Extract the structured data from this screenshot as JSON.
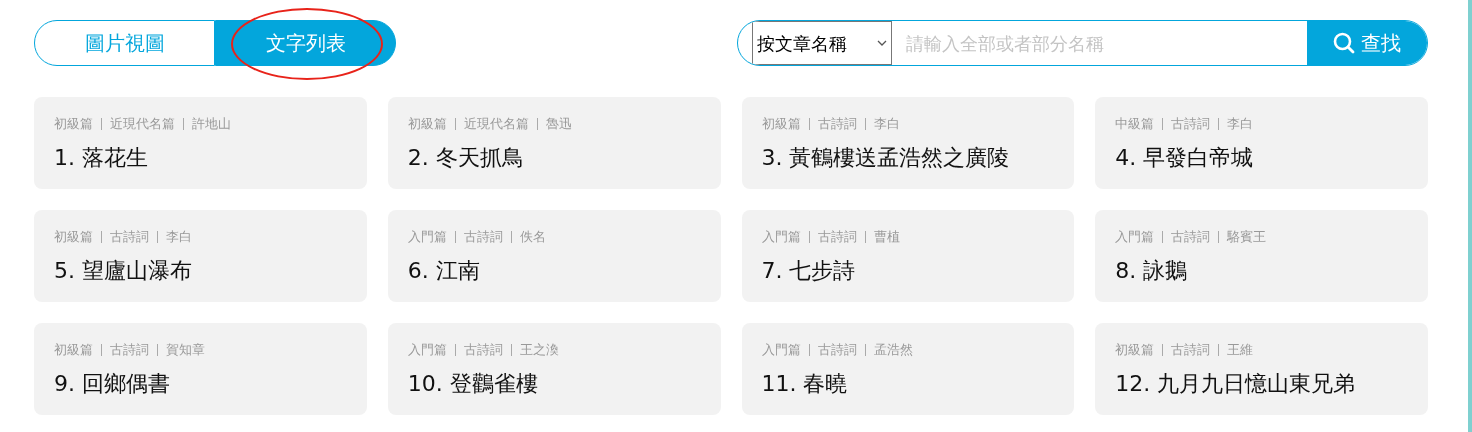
{
  "view_tabs": [
    {
      "label": "圖片視圖",
      "selected": false
    },
    {
      "label": "文字列表",
      "selected": true
    }
  ],
  "annotations": [
    {
      "kind": "ellipse"
    }
  ],
  "search": {
    "scope": "按文章名稱",
    "placeholder": "請輸入全部或者部分名稱",
    "button": "查找"
  },
  "articles": [
    {
      "tags": [
        "初級篇",
        "近現代名篇",
        "許地山"
      ],
      "title": "1. 落花生"
    },
    {
      "tags": [
        "初級篇",
        "近現代名篇",
        "魯迅"
      ],
      "title": "2. 冬天抓鳥"
    },
    {
      "tags": [
        "初級篇",
        "古詩詞",
        "李白"
      ],
      "title": "3. 黃鶴樓送孟浩然之廣陵"
    },
    {
      "tags": [
        "中級篇",
        "古詩詞",
        "李白"
      ],
      "title": "4. 早發白帝城"
    },
    {
      "tags": [
        "初級篇",
        "古詩詞",
        "李白"
      ],
      "title": "5. 望廬山瀑布"
    },
    {
      "tags": [
        "入門篇",
        "古詩詞",
        "佚名"
      ],
      "title": "6. 江南"
    },
    {
      "tags": [
        "入門篇",
        "古詩詞",
        "曹植"
      ],
      "title": "7. 七步詩"
    },
    {
      "tags": [
        "入門篇",
        "古詩詞",
        "駱賓王"
      ],
      "title": "8. 詠鵝"
    },
    {
      "tags": [
        "初級篇",
        "古詩詞",
        "賀知章"
      ],
      "title": "9. 回鄉偶書"
    },
    {
      "tags": [
        "入門篇",
        "古詩詞",
        "王之渙"
      ],
      "title": "10. 登鸛雀樓"
    },
    {
      "tags": [
        "入門篇",
        "古詩詞",
        "孟浩然"
      ],
      "title": "11. 春曉"
    },
    {
      "tags": [
        "初級篇",
        "古詩詞",
        "王維"
      ],
      "title": "12. 九月九日憶山東兄弟"
    }
  ]
}
